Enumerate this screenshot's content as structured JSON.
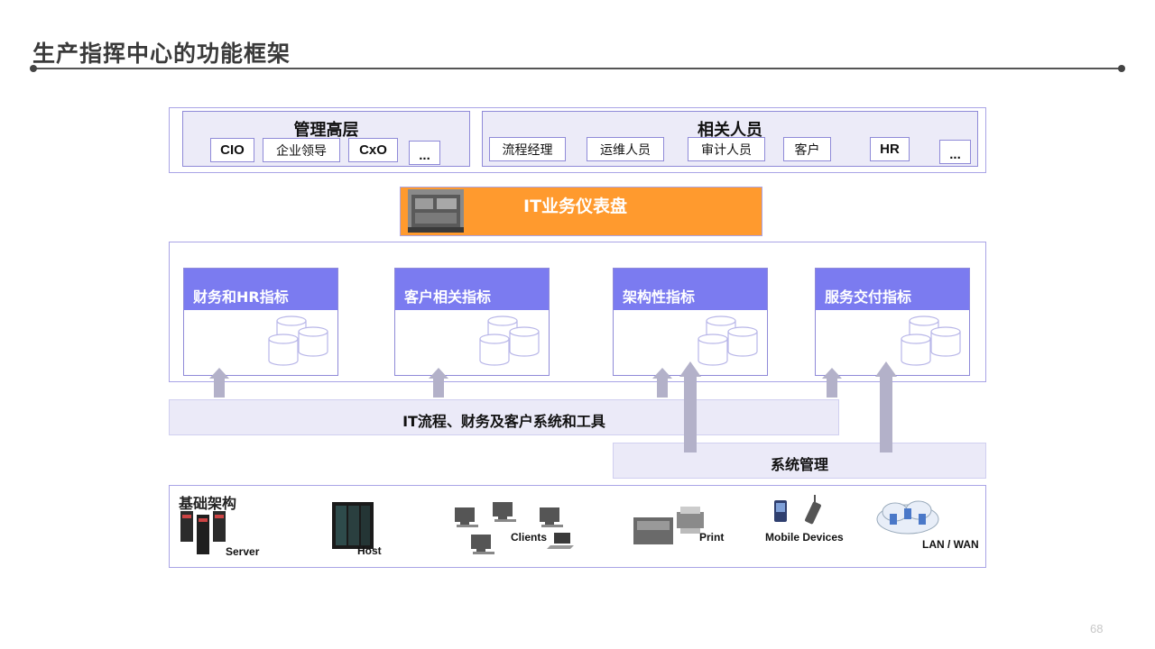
{
  "slide": {
    "title": "生产指挥中心的功能框架",
    "page_number": "68"
  },
  "management": {
    "title": "管理高层",
    "items": [
      "CIO",
      "企业领导",
      "CxO",
      "..."
    ]
  },
  "stakeholders": {
    "title": "相关人员",
    "items": [
      "流程经理",
      "运维人员",
      "审计人员",
      "客户",
      "HR",
      "..."
    ]
  },
  "dashboard": {
    "label": "IT业务仪表盘"
  },
  "metrics": [
    {
      "label": "财务和HR指标"
    },
    {
      "label": "客户相关指标"
    },
    {
      "label": "架构性指标"
    },
    {
      "label": "服务交付指标"
    }
  ],
  "tools_bar": {
    "label": "IT流程、财务及客户系统和工具"
  },
  "system_mgmt": {
    "label": "系统管理"
  },
  "infrastructure": {
    "title": "基础架构",
    "items": [
      "Server",
      "Host",
      "Clients",
      "Print",
      "Mobile Devices",
      "LAN / WAN"
    ]
  },
  "colors": {
    "accent_orange": "#ff9a2e",
    "card_header_blue": "#7b7bf0",
    "border_lavender": "#a9a4e6",
    "bar_fill": "#ebeaf8",
    "arrow_gray": "#b3b1c9"
  }
}
